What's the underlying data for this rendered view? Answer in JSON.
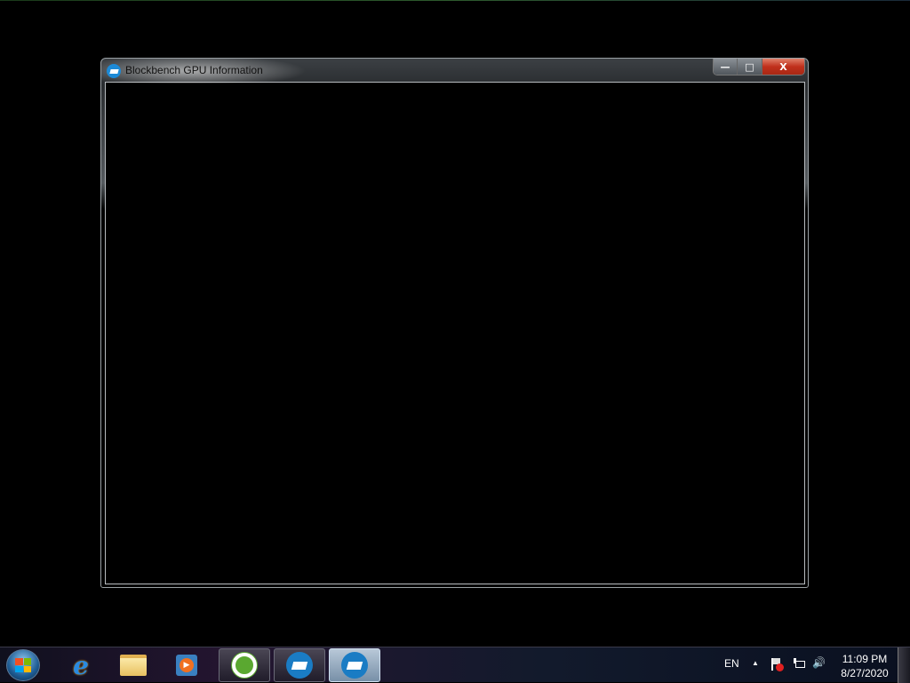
{
  "window": {
    "title": "Blockbench GPU Information",
    "minimize_glyph": "—",
    "maximize_glyph": "□",
    "close_glyph": "X"
  },
  "taskbar": {
    "start": "start-button",
    "pinned": [
      "internet-explorer",
      "windows-explorer",
      "windows-media-player"
    ],
    "tasks": [
      "ccleaner",
      "blockbench",
      "blockbench-gpu-information"
    ],
    "tray": {
      "language": "EN",
      "arrow": "▲",
      "volume": "🔊"
    },
    "clock": {
      "time": "11:09 PM",
      "date": "8/27/2020"
    }
  }
}
